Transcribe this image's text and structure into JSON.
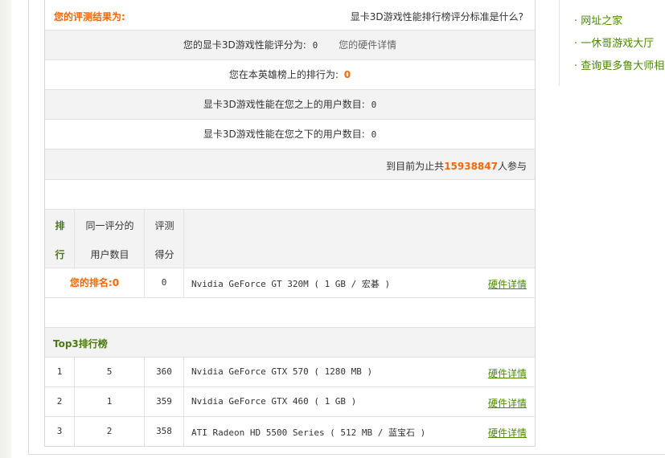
{
  "result": {
    "title": "您的评测结果为:",
    "help_link": "显卡3D游戏性能排行榜评分标准是什么?",
    "score_label": "您的显卡3D游戏性能评分为:",
    "score_value": "0",
    "hardware_link": "您的硬件详情",
    "rank_label": "您在本英雄榜上的排行为:",
    "rank_value": "0",
    "above_label": "显卡3D游戏性能在您之上的用户数目:",
    "above_value": "0",
    "below_label": "显卡3D游戏性能在您之下的用户数目:",
    "below_value": "0",
    "participants_prefix": "到目前为止共",
    "participants_value": "15938847",
    "participants_suffix": "人参与"
  },
  "table": {
    "headers": {
      "rank_line1": "排",
      "rank_line2": "行",
      "users_line1": "同一评分的",
      "users_line2": "用户数目",
      "score_line1": "评测",
      "score_line2": "得分"
    },
    "my_rank": {
      "label": "您的排名:",
      "value": "0",
      "score": "0",
      "card": "Nvidia GeForce GT 320M ( 1 GB / 宏碁 )",
      "link": "硬件详情"
    },
    "top3_title": "Top3排行榜",
    "rows": [
      {
        "rank": "1",
        "users": "5",
        "score": "360",
        "card": "Nvidia GeForce GTX 570 ( 1280 MB )",
        "link": "硬件详情"
      },
      {
        "rank": "2",
        "users": "1",
        "score": "359",
        "card": "Nvidia GeForce GTX 460 ( 1 GB )",
        "link": "硬件详情"
      },
      {
        "rank": "3",
        "users": "2",
        "score": "358",
        "card": "ATI Radeon HD 5500 Series ( 512 MB / 蓝宝石 )",
        "link": "硬件详情"
      }
    ]
  },
  "sidebar": {
    "items": [
      {
        "label": "· 网址之家"
      },
      {
        "label": "· 一休哥游戏大厅"
      },
      {
        "label": "· 查询更多鲁大师相关"
      }
    ]
  },
  "colors": {
    "accent_orange": "#ff6600",
    "link_green": "#4a8a00",
    "row_gray": "#f3f3f3"
  }
}
